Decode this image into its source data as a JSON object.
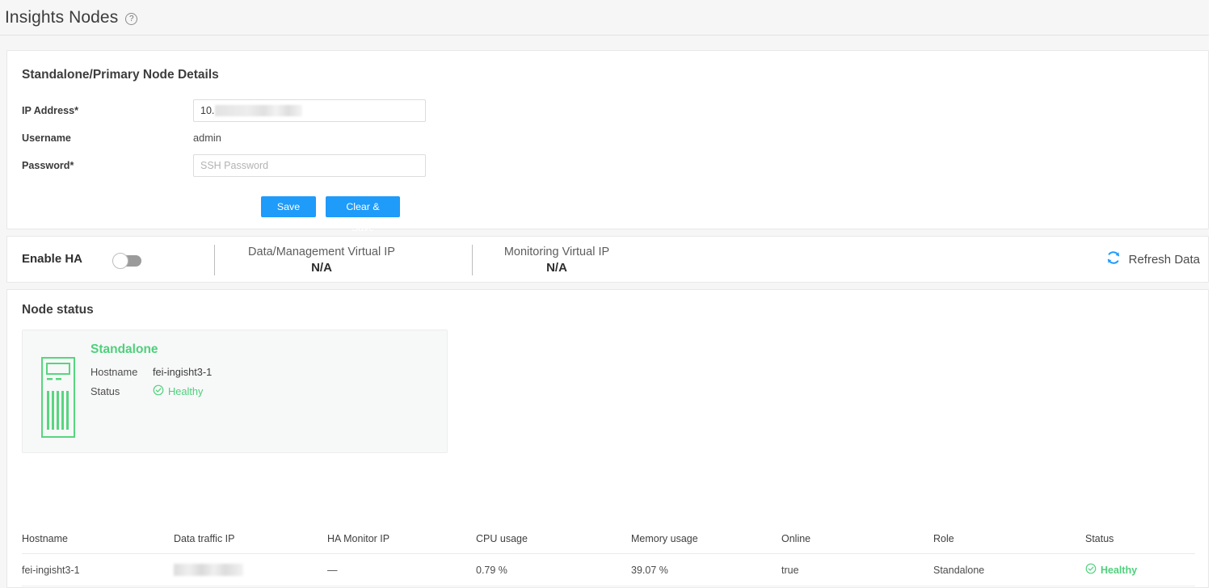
{
  "header": {
    "title": "Insights Nodes",
    "help_icon": "help-circle-icon"
  },
  "details": {
    "title": "Standalone/Primary Node Details",
    "ip_label": "IP Address*",
    "ip_value": "10.",
    "ip_redacted": true,
    "username_label": "Username",
    "username_value": "admin",
    "password_label": "Password*",
    "password_placeholder": "SSH Password",
    "password_value": "",
    "save_label": "Save",
    "clear_save_label": "Clear & Save",
    "button_color": "#1f9bfa"
  },
  "ha": {
    "enable_label": "Enable HA",
    "toggle_state": "off",
    "data_vip_label": "Data/Management Virtual IP",
    "data_vip_value": "N/A",
    "monitor_vip_label": "Monitoring Virtual IP",
    "monitor_vip_value": "N/A",
    "refresh_label": "Refresh Data",
    "refresh_icon": "refresh-icon",
    "refresh_color": "#1f9bfa"
  },
  "node_status": {
    "title": "Node status",
    "card": {
      "role": "Standalone",
      "server_icon": "server-tower-icon",
      "hostname_label": "Hostname",
      "hostname_value": "fei-ingisht3-1",
      "status_label": "Status",
      "status_value": "Healthy",
      "status_icon": "check-circle-icon",
      "status_color": "#4ed07c"
    }
  },
  "table": {
    "columns": [
      "Hostname",
      "Data traffic IP",
      "HA Monitor IP",
      "CPU usage",
      "Memory usage",
      "Online",
      "Role",
      "Status"
    ],
    "rows": [
      {
        "hostname": "fei-ingisht3-1",
        "data_traffic_ip": "",
        "data_traffic_ip_redacted": true,
        "ha_monitor_ip": "—",
        "cpu_usage": "0.79 %",
        "memory_usage": "39.07 %",
        "online": "true",
        "role": "Standalone",
        "status": "Healthy",
        "status_icon": "check-circle-icon"
      }
    ]
  }
}
